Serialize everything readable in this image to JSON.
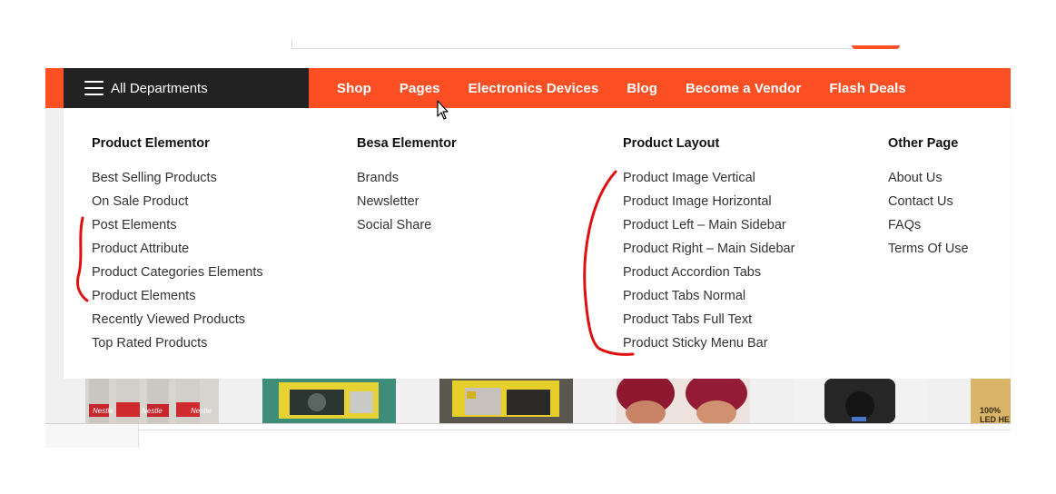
{
  "colors": {
    "accent": "#fd4f24",
    "dark": "#222222",
    "annotation": "#e01010"
  },
  "departments": {
    "label": "All Departments",
    "icon": "hamburger-menu-icon"
  },
  "menu": [
    {
      "label": "Shop"
    },
    {
      "label": "Pages"
    },
    {
      "label": "Electronics Devices"
    },
    {
      "label": "Blog"
    },
    {
      "label": "Become a Vendor"
    },
    {
      "label": "Flash Deals"
    }
  ],
  "mega_menu": {
    "columns": [
      {
        "title": "Product Elementor",
        "items": [
          "Best Selling Products",
          "On Sale Product",
          "Post Elements",
          "Product Attribute",
          "Product Categories Elements",
          "Product Elements",
          "Recently Viewed Products",
          "Top Rated Products"
        ]
      },
      {
        "title": "Besa Elementor",
        "items": [
          "Brands",
          "Newsletter",
          "Social Share"
        ]
      },
      {
        "title": "Product Layout",
        "items": [
          "Product Image Vertical",
          "Product Image Horizontal",
          "Product Left – Main Sidebar",
          "Product Right – Main Sidebar",
          "Product Accordion Tabs",
          "Product Tabs Normal",
          "Product Tabs Full Text",
          "Product Sticky Menu Bar"
        ]
      },
      {
        "title": "Other Page",
        "items": [
          "About Us",
          "Contact Us",
          "FAQs",
          "Terms Of Use"
        ]
      }
    ]
  },
  "product_strip": {
    "labels": [
      "Nestle",
      "Nestle",
      "Nestle",
      "100%",
      "LED HE"
    ]
  }
}
